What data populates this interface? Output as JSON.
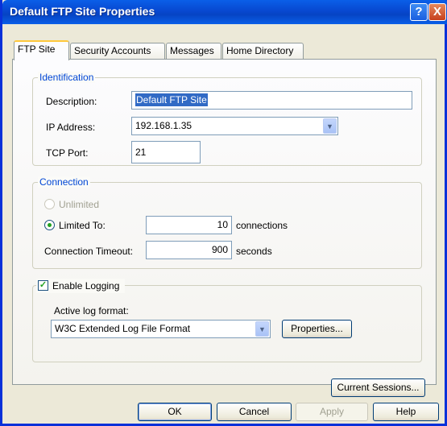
{
  "window": {
    "title": "Default FTP Site Properties",
    "help_glyph": "?",
    "close_glyph": "X"
  },
  "tabs": [
    {
      "label": "FTP Site",
      "active": true
    },
    {
      "label": "Security Accounts",
      "active": false
    },
    {
      "label": "Messages",
      "active": false
    },
    {
      "label": "Home Directory",
      "active": false
    }
  ],
  "identification": {
    "legend": "Identification",
    "description_label": "Description:",
    "description_value": "Default FTP Site",
    "ip_label": "IP Address:",
    "ip_value": "192.168.1.35",
    "port_label": "TCP Port:",
    "port_value": "21"
  },
  "connection": {
    "legend": "Connection",
    "unlimited_label": "Unlimited",
    "limited_label": "Limited To:",
    "limited_value": "10",
    "limited_unit": "connections",
    "timeout_label": "Connection Timeout:",
    "timeout_value": "900",
    "timeout_unit": "seconds"
  },
  "logging": {
    "enable_label": "Enable Logging",
    "enabled": true,
    "format_label": "Active log format:",
    "format_value": "W3C Extended Log File Format",
    "properties_button": "Properties..."
  },
  "current_sessions_button": "Current Sessions...",
  "footer": {
    "ok": "OK",
    "cancel": "Cancel",
    "apply": "Apply",
    "help": "Help"
  },
  "colors": {
    "title_bar": "#0a5fe8",
    "legend_text": "#0046d5",
    "check_mark": "#21a121",
    "selection": "#316ac5"
  }
}
